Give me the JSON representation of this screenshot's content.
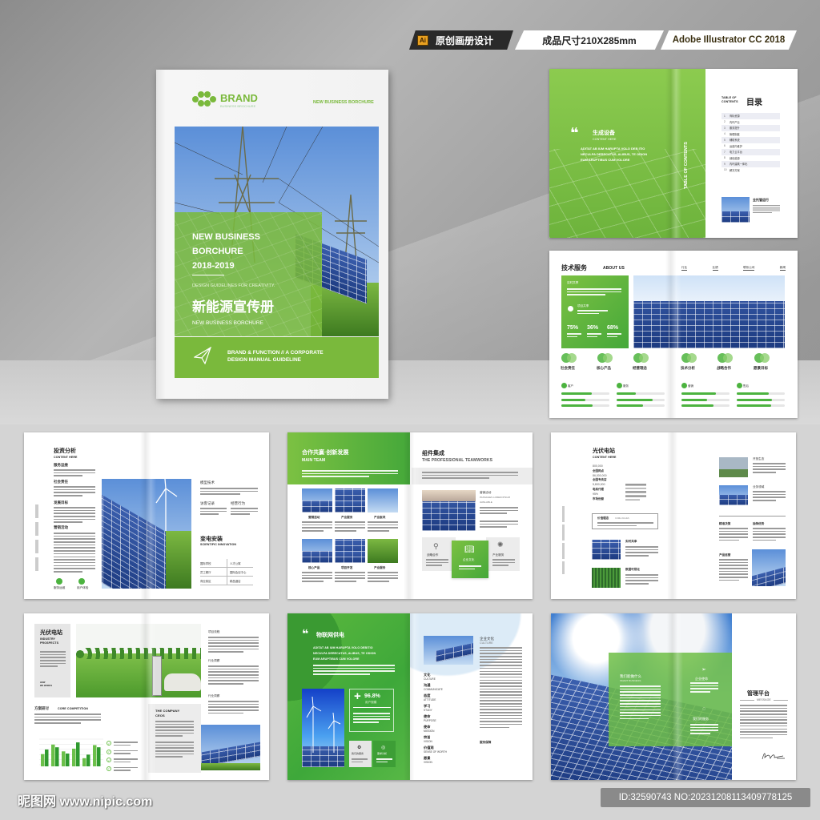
{
  "header": {
    "badge_ai": "Ai",
    "badge_original": "原创画册设计",
    "badge_size": "成品尺寸210X285mm",
    "badge_software": "Adobe Illustrator CC 2018"
  },
  "colors": {
    "accent": "#7ab93c",
    "accent_dark": "#45a83a"
  },
  "cover": {
    "brand": "BRAND",
    "brand_sub": "BUSINESS BROCHURE",
    "top_right": "NEW BUSINESS BORCHURE",
    "title_1": "NEW BUSINESS",
    "title_2": "BORCHURE",
    "title_3": "2018-2019",
    "tagline": "DESIGN GUIDELINES FOR CREATIVITY.",
    "title_cn": "新能源宣传册",
    "subtitle": "NEW BUSINESS BORCHURE",
    "footer_1": "BRAND & FUNCTION // A CORPORATE",
    "footer_2": "DESIGN MANUAL GUIDELINE"
  },
  "toc_spread": {
    "title": "生成设备",
    "subtitle": "CONTENT HERE",
    "body": "ADITAT AB IUM HARUPTA VOLO DEB ITIO NECULPA DERECATUS, ALIBUS, TE ODION EUM ARUPTIBUS CUM VOLORE",
    "vertical": "TABLE OF CONTENTS",
    "toc_en_1": "TABLE OF",
    "toc_en_2": "CONTENTS",
    "toc_cn": "目录",
    "items": [
      "商标资源",
      "内环产业",
      "服务提升",
      "管理制度",
      "辅助系统",
      "运道内维护",
      "电力云平台",
      "绿色能源",
      "内环建筑一体化",
      "解决方案"
    ],
    "feature": "全托管运行"
  },
  "about_spread": {
    "title": "技术服务",
    "title_en": "ABOUT US",
    "nav": [
      "行业",
      "业绩",
      "联系公司",
      "新闻"
    ],
    "box_label": "实时共享",
    "box_item": "项目共享",
    "stats": [
      "75%",
      "36%",
      "68%"
    ],
    "circles": [
      "社会责任",
      "核心产品",
      "经营理念",
      "技术分析",
      "战略合作",
      "愿景目标"
    ],
    "progress": [
      {
        "label": "客户",
        "values": [
          0.63,
          0.5,
          0.65
        ]
      },
      {
        "label": "服务",
        "values": [
          0.4,
          0.75,
          0.55
        ]
      },
      {
        "label": "营销",
        "values": [
          0.72,
          0.53,
          0.66
        ]
      },
      {
        "label": "售后",
        "values": [
          0.66,
          0.74,
          0.72
        ]
      }
    ]
  },
  "invest_spread": {
    "title": "投资分析",
    "subtitle": "CONTENT HERE",
    "sections": [
      "服务运维",
      "社会责任",
      "发展目标",
      "营销活动"
    ],
    "icons": [
      "服务运维",
      "用户体验"
    ],
    "right_1": "模型技术",
    "right_2": "访客记录",
    "right_3": "经营行为",
    "heading": "变电安装",
    "heading_en": "SCIENTIFIC INNOVATION",
    "table": [
      [
        "国际学校",
        "人才公寓"
      ],
      [
        "员工餐厅",
        "国际会议中心"
      ],
      [
        "商业街区",
        "精品酒店"
      ]
    ]
  },
  "team_spread": {
    "title": "合作共赢·创新发展",
    "title_en": "MAIN TEAM",
    "grid": [
      "营销活动",
      "产业服务",
      "产业板块",
      "核心产品",
      "项目开发",
      "产业服务"
    ],
    "right_title": "组件集成",
    "right_title_en": "THE PROFESSIONAL TEAMWORKS",
    "feature": "营销活动",
    "feature_sub_1": "PASSAGES LOREM IPSUM",
    "feature_sub_2": "AVAILABLE",
    "boxes": [
      "战略合作",
      "企业文化",
      "产业服务"
    ]
  },
  "station_spread": {
    "title": "光伏电站",
    "subtitle": "CONTENT HERE",
    "stats": [
      "800,000",
      "全国网点",
      "86,000,000",
      "全国专卖店",
      "5,800,000",
      "电商代理",
      "95%",
      "市场份额"
    ],
    "value_box": "价值理念",
    "value_box_en": "CORE VALUES",
    "items": [
      "实时共享",
      "数据可视化"
    ],
    "right": [
      "开放生态",
      "业务领域",
      "精准决策",
      "独特优势",
      "产品运营"
    ]
  },
  "prospect_spread": {
    "title": "光伏电站",
    "title_en_1": "INDUSTRY",
    "title_en_2": "PROSPECTS",
    "how": "HOW",
    "works": "WE WORKS",
    "section": "方案研讨",
    "section_en": "CORE COMPETITION",
    "ceo_1": "THE COMPANY",
    "ceo_2": "CEOS",
    "right": [
      "项目流程",
      "行业洞察",
      "行业洞察"
    ],
    "chart_bars": [
      [
        45,
        62
      ],
      [
        80,
        70
      ],
      [
        55,
        47
      ],
      [
        65,
        88
      ],
      [
        30,
        43
      ],
      [
        78,
        70
      ]
    ]
  },
  "iot_spread": {
    "title": "物联网供电",
    "body_1": "ADITAT AB IUM HARUPTA VOLO DEBITIO",
    "body_2": "NECULPA DERECATUS, ALIBUS, TE ODION",
    "body_3": "EUM ARUPTIBUS CUM VOLORE",
    "stat": "96.8%",
    "stat_label": "用户规模",
    "btn_1": "我们的服务",
    "btn_2": "需求分析",
    "culture": "企业文化",
    "culture_en": "CULTURE",
    "values": [
      [
        "文化",
        "CULTURE"
      ],
      [
        "沟通",
        "COMMUNICATE"
      ],
      [
        "态度",
        "ATTITUDE"
      ],
      [
        "学习",
        "STUDY"
      ],
      [
        "使命",
        "PURPOSE"
      ],
      [
        "使命",
        "MISSION"
      ],
      [
        "宗旨",
        "VISION"
      ],
      [
        "价值观",
        "SENSE OF WORTH"
      ],
      [
        "愿景",
        "VISION"
      ]
    ],
    "service": "服务保障"
  },
  "platform_spread": {
    "smart": "我们能做什么",
    "smart_en": "SMART BUSINESS",
    "mission": "企业使命",
    "service": "我们的服务",
    "title": "管理平台",
    "message": "MESSAGE"
  },
  "watermark": {
    "logo": "昵图网 www.nipic.com",
    "id": "ID:32590743 NO:20231208113409778125"
  }
}
